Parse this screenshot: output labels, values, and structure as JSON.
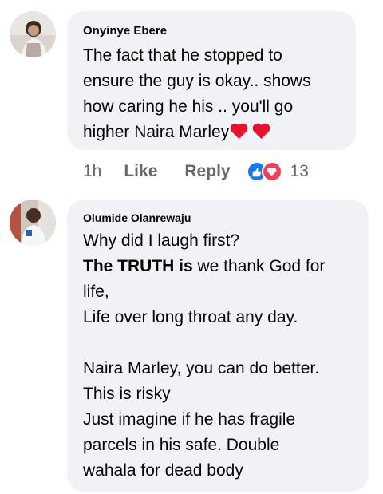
{
  "comments": [
    {
      "author": "Onyinye Ebere",
      "lines": [
        "The fact that he stopped to",
        "ensure the guy is okay.. shows",
        "how caring he his .. you'll go",
        "higher Naira Marley"
      ],
      "time": "1h",
      "like_label": "Like",
      "reply_label": "Reply",
      "reaction_count": "13",
      "reaction_icons": [
        "like-icon",
        "heart-icon"
      ]
    },
    {
      "author": "Olumide Olanrewaju",
      "line1": "Why did I laugh first?",
      "line2_bold": "The TRUTH is",
      "line2_rest": " we thank God for",
      "line3": "life,",
      "line4": "Life over long throat any day.",
      "line5": "Naira Marley, you can do better.",
      "line6": "This is risky",
      "line7": "Just imagine if he has fragile",
      "line8": "parcels in his safe. Double",
      "line9": "wahala for dead body"
    }
  ],
  "colors": {
    "bubble": "#f0f2f5",
    "meta": "#65676b",
    "like_blue": "#1877f2",
    "heart_red": "#f33e58"
  }
}
